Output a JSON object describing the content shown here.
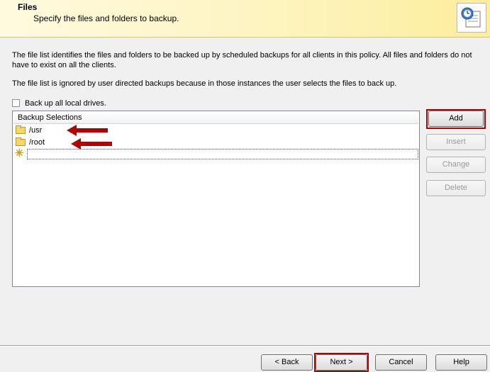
{
  "header": {
    "title": "Files",
    "subtitle": "Specify the files and folders to backup.",
    "icon": "backup-selections-icon"
  },
  "description": {
    "line1": "The file list identifies the files and folders to be backed up by scheduled backups for all clients in this policy.  All files and folders do not have to exist on all the clients.",
    "line2": "The file list is ignored by user directed backups because in those instances the user selects the files to back up."
  },
  "backup_all_drives": {
    "label": "Back up all local drives.",
    "checked": false
  },
  "list": {
    "header": "Backup Selections",
    "items": [
      {
        "name": "/usr",
        "icon": "folder-icon"
      },
      {
        "name": "/root",
        "icon": "folder-icon"
      }
    ],
    "new_item_icon": "new-item-star-icon"
  },
  "side_buttons": {
    "add": "Add",
    "insert": "Insert",
    "change": "Change",
    "delete": "Delete"
  },
  "footer": {
    "back": "< Back",
    "next": "Next >",
    "cancel": "Cancel",
    "help": "Help"
  },
  "colors": {
    "highlight": "#b40000",
    "header_bg": "#fdf4c0"
  }
}
